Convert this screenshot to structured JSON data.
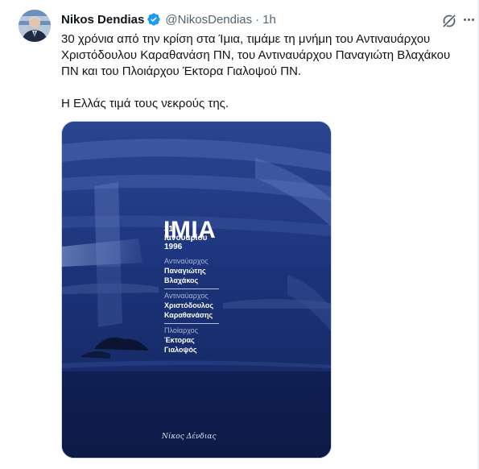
{
  "tweet": {
    "author_name": "Nikos Dendias",
    "handle": "@NikosDendias",
    "separator": "·",
    "time": "1h",
    "text_paragraph_1": "30 χρόνια από την κρίση στα Ίμια, τιμάμε τη μνήμη του Αντιναυάρχου Χριστόδουλου Καραθανάση ΠΝ, του Αντιναυάρχου Παναγιώτη Βλαχάκου ΠΝ και του Πλοιάρχου Έκτορα Γιαλοψού ΠΝ.",
    "text_paragraph_2": "Η Ελλάς τιμά τους νεκρούς της."
  },
  "poster": {
    "title": "ΙΜΙΑ",
    "date": "31 Ιανουαρίου 1996",
    "entries": [
      {
        "role": "Αντιναύαρχος",
        "name_line1": "Παναγιώτης",
        "name_line2": "Βλαχάκος"
      },
      {
        "role": "Αντιναύαρχος",
        "name_line1": "Χριστόδουλος",
        "name_line2": "Καραθανάσης"
      },
      {
        "role": "Πλοίαρχος",
        "name_line1": "Έκτορας",
        "name_line2": "Γιαλοψός"
      }
    ],
    "signature": "Νίκος Δένδιας"
  },
  "icons": {
    "verified": "verified-badge-icon",
    "grok": "grok-icon",
    "more": "more-options-icon"
  },
  "colors": {
    "verified_blue": "#1d9bf0",
    "text_primary": "#0f1419",
    "text_secondary": "#536471",
    "poster_navy": "#13245a"
  }
}
